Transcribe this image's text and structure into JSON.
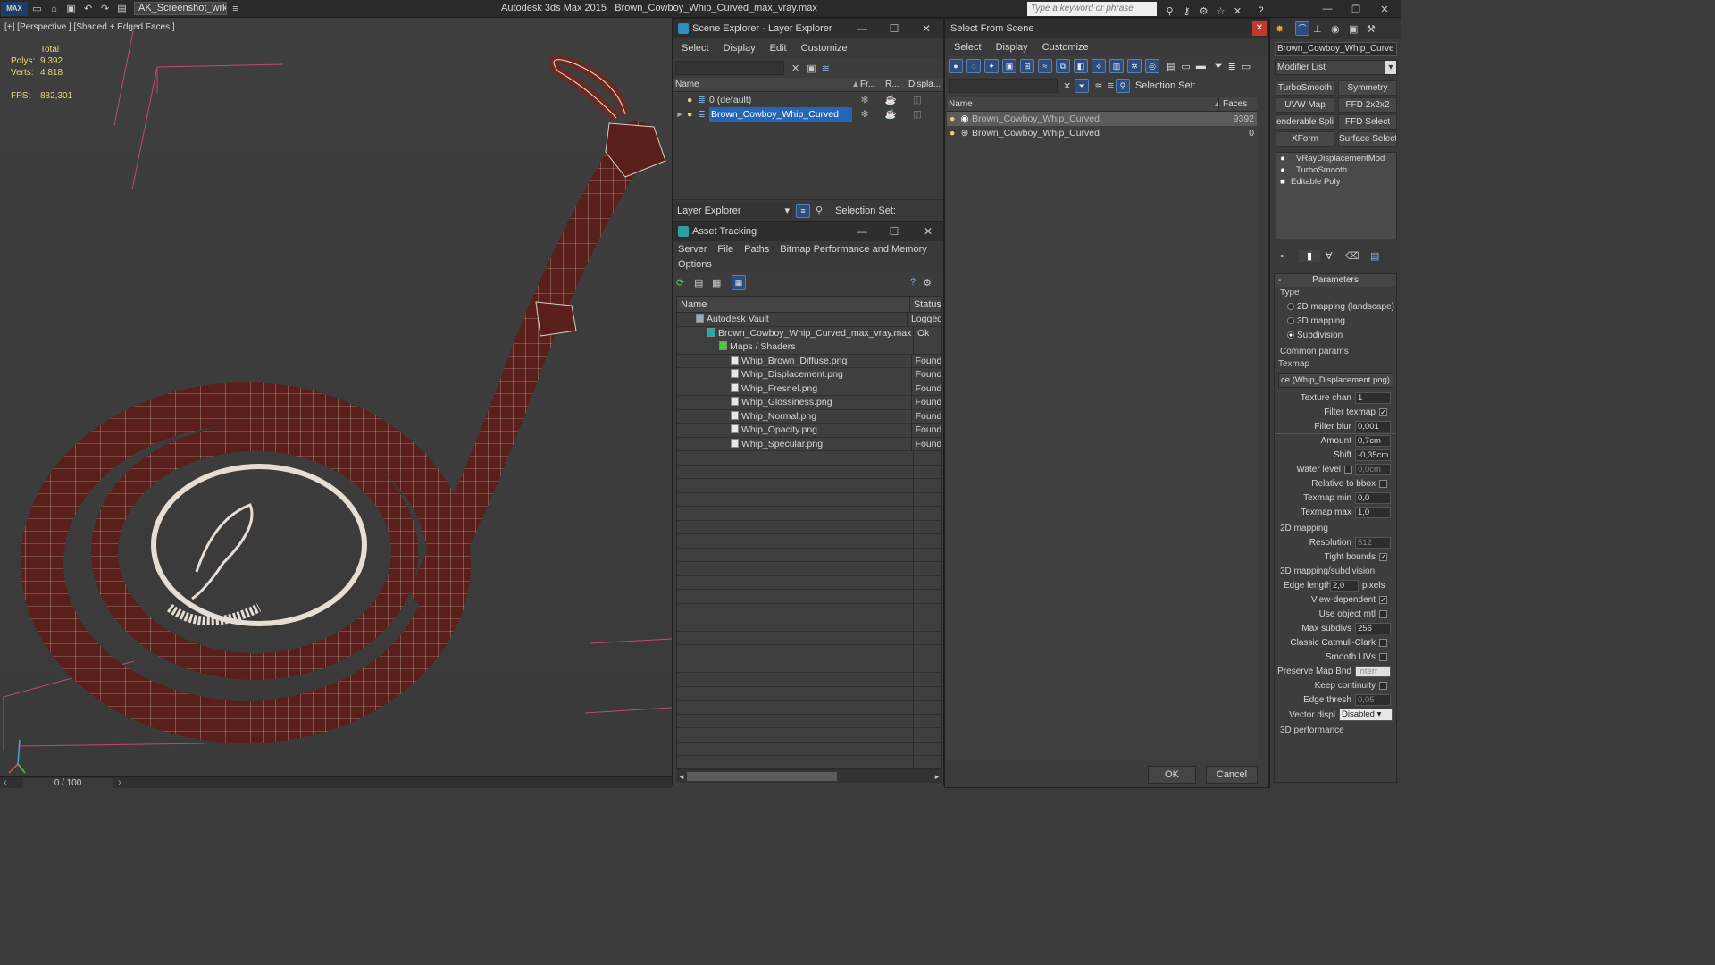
{
  "app": {
    "title": "Autodesk 3ds Max  2015",
    "file_title": "Brown_Cowboy_Whip_Curved_max_vray.max",
    "workspace": "AK_Screenshot_wrksp",
    "search_placeholder": "Type a keyword or phrase"
  },
  "viewport": {
    "label": "[+] [Perspective ] [Shaded + Edged Faces ]",
    "stats": {
      "total_label": "Total",
      "polys_label": "Polys:",
      "polys": "9 392",
      "verts_label": "Verts:",
      "verts": "4 818",
      "fps_label": "FPS:",
      "fps": "882,301"
    },
    "timeline": "0 / 100",
    "mesh_color": "#5a1f1a",
    "wire_color": "#e8e0d8"
  },
  "scene_explorer": {
    "title": "Scene Explorer - Layer Explorer",
    "menu": [
      "Select",
      "Display",
      "Edit",
      "Customize"
    ],
    "columns": [
      "Name",
      "Fr...",
      "R...",
      "Displa..."
    ],
    "rows": [
      {
        "name": "0 (default)",
        "selected": false
      },
      {
        "name": "Brown_Cowboy_Whip_Curved",
        "selected": true
      }
    ],
    "footer_dropdown": "Layer Explorer",
    "selection_set_label": "Selection Set:"
  },
  "asset_tracking": {
    "title": "Asset Tracking",
    "menu": [
      "Server",
      "File",
      "Paths",
      "Bitmap Performance and Memory"
    ],
    "menu2": [
      "Options"
    ],
    "columns": [
      "Name",
      "Status"
    ],
    "rows": [
      {
        "name": "Autodesk Vault",
        "status": "Logged",
        "indent": 1
      },
      {
        "name": "Brown_Cowboy_Whip_Curved_max_vray.max",
        "status": "Ok",
        "indent": 2
      },
      {
        "name": "Maps / Shaders",
        "status": "",
        "indent": 3
      },
      {
        "name": "Whip_Brown_Diffuse.png",
        "status": "Found",
        "indent": 4
      },
      {
        "name": "Whip_Displacement.png",
        "status": "Found",
        "indent": 4
      },
      {
        "name": "Whip_Fresnel.png",
        "status": "Found",
        "indent": 4
      },
      {
        "name": "Whip_Glossiness.png",
        "status": "Found",
        "indent": 4
      },
      {
        "name": "Whip_Normal.png",
        "status": "Found",
        "indent": 4
      },
      {
        "name": "Whip_Opacity.png",
        "status": "Found",
        "indent": 4
      },
      {
        "name": "Whip_Specular.png",
        "status": "Found",
        "indent": 4
      }
    ]
  },
  "select_from_scene": {
    "title": "Select From Scene",
    "menu": [
      "Select",
      "Display",
      "Customize"
    ],
    "selection_set_label": "Selection Set:",
    "columns": [
      "Name",
      "Faces"
    ],
    "rows": [
      {
        "name": "Brown_Cowboy_Whip_Curved",
        "faces": "9392",
        "selected": true
      },
      {
        "name": "Brown_Cowboy_Whip_Curved",
        "faces": "0",
        "selected": false
      }
    ],
    "ok": "OK",
    "cancel": "Cancel"
  },
  "command_panel": {
    "object_name": "Brown_Cowboy_Whip_Curve",
    "modifier_list": "Modifier List",
    "buttons": [
      "TurboSmooth",
      "Symmetry",
      "UVW Map",
      "FFD 2x2x2",
      "enderable Splir",
      "FFD Select",
      "XForm",
      "Surface Select"
    ],
    "stack": [
      "VRayDisplacementMod",
      "TurboSmooth",
      "Editable Poly"
    ],
    "rollout_title": "Parameters",
    "type_label": "Type",
    "types": [
      "2D mapping (landscape)",
      "3D mapping",
      "Subdivision"
    ],
    "common_params": "Common params",
    "texmap_label": "Texmap",
    "texmap_value": "ce (Whip_Displacement.png)",
    "params": [
      {
        "label": "Texture chan",
        "value": "1",
        "type": "spin"
      },
      {
        "label": "Filter texmap",
        "value": "✓",
        "type": "check"
      },
      {
        "label": "Filter blur",
        "value": "0,001",
        "type": "spin"
      },
      {
        "label": "Amount",
        "value": "0,7cm",
        "type": "spin"
      },
      {
        "label": "Shift",
        "value": "-0,35cm",
        "type": "spin"
      },
      {
        "label": "Water level",
        "value": "0,0cm",
        "type": "spin"
      },
      {
        "label": "Relative to bbox",
        "value": "",
        "type": "check"
      },
      {
        "label": "Texmap min",
        "value": "0,0",
        "type": "spin"
      },
      {
        "label": "Texmap max",
        "value": "1,0",
        "type": "spin"
      }
    ],
    "mapping2d_label": "2D mapping",
    "resolution_label": "Resolution",
    "resolution": "512",
    "tight_bounds_label": "Tight bounds",
    "mapping3d_label": "3D mapping/subdivision",
    "edge_length_label": "Edge length",
    "edge_length": "2,0",
    "pixels_label": "pixels",
    "view_dependent_label": "View-dependent",
    "use_object_mtl_label": "Use object mtl",
    "max_subdivs_label": "Max subdivs",
    "max_subdivs": "256",
    "catmull_label": "Classic Catmull-Clark",
    "smooth_uvs_label": "Smooth UVs",
    "preserve_label": "Preserve Map Bnd",
    "preserve_value": "Interr",
    "keep_continuity_label": "Keep continuity",
    "edge_thresh_label": "Edge thresh",
    "edge_thresh": "0,05",
    "vector_displ_label": "Vector displ",
    "vector_displ": "Disabled",
    "perf_label": "3D performance"
  }
}
